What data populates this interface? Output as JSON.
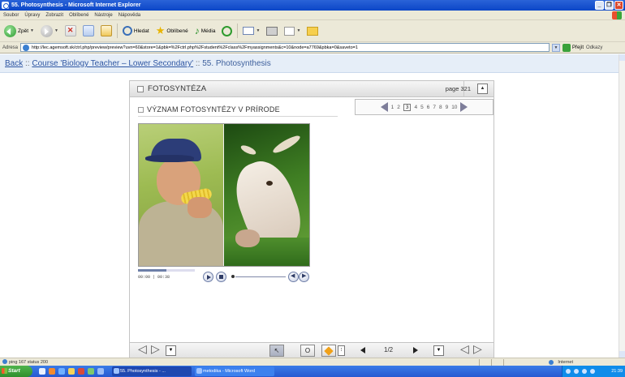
{
  "window": {
    "title": "55. Photosynthesis - Microsoft Internet Explorer",
    "buttons": [
      "_",
      "❐",
      "✕"
    ]
  },
  "menu": [
    "Soubor",
    "Úpravy",
    "Zobrazit",
    "Oblíbené",
    "Nástroje",
    "Nápověda"
  ],
  "toolbar": {
    "back_label": "Zpět",
    "search_label": "Hledat",
    "favorites_label": "Oblíbené",
    "media_label": "Média"
  },
  "address": {
    "label": "Adresa",
    "url": "http://lec.agemsoft.sk/ctrl.php/preview/preview?uvn=60&store=1&pbk=%2Fctrl.php%2Fstudent%2Fclass%2Fmyassignments&c=10&node=a7769&pbka=0&saveto=1",
    "go_label": "Přejít",
    "links_label": "Odkazy"
  },
  "breadcrumb": {
    "back": "Back",
    "sep1": " :: ",
    "course": "Course 'Biology Teacher – Lower Secondary'",
    "sep2": " :: ",
    "current": "55. Photosynthesis"
  },
  "lesson": {
    "title": "FOTOSYNTÉZA",
    "page_label": "page 321",
    "section_title": "VÝZNAM FOTOSYNTÉZY V PRÍRODE",
    "pages": [
      "1",
      "2",
      "3",
      "4",
      "5",
      "6",
      "7",
      "8",
      "9",
      "10"
    ],
    "active_page": "3"
  },
  "player": {
    "time": "00:00 | 00:38",
    "progress": 0.5
  },
  "bottom_nav": {
    "page_count": "1/2"
  },
  "status": {
    "text": "ping 167 status 200",
    "zone": "Internet"
  },
  "taskbar": {
    "start_label": "Start",
    "tasks": [
      "55. Photosynthesis - ...",
      "metodika - Microsoft Word"
    ],
    "clock": "21:39"
  }
}
